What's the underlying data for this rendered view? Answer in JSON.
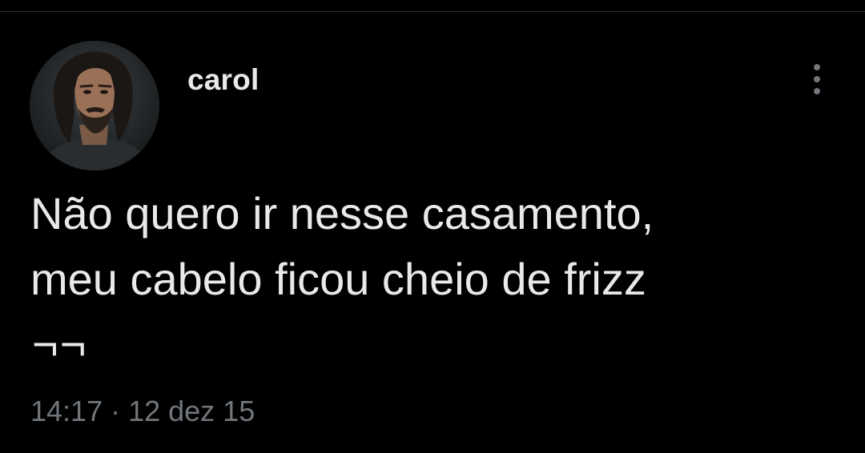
{
  "tweet": {
    "author": {
      "name": "carol",
      "avatar_alt": "avatar"
    },
    "text_lines": [
      "Não quero ir nesse casamento,",
      "meu cabelo ficou cheio de frizz",
      "¬¬"
    ],
    "time": "14:17",
    "separator": "·",
    "date": "12 dez 15",
    "more_icon": "more-vertical-icon"
  },
  "colors": {
    "background": "#000000",
    "primary_text": "#e7e9ea",
    "secondary_text": "#71767b",
    "divider": "#2f3336"
  }
}
